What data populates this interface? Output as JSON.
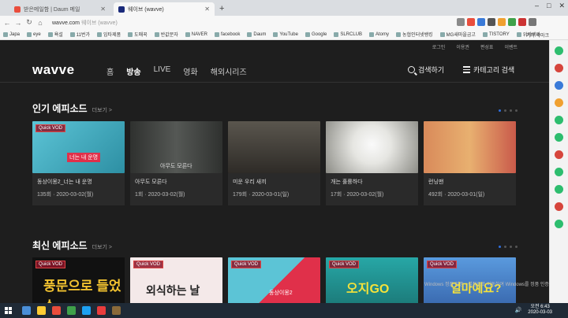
{
  "browser": {
    "tabs": [
      {
        "label": "받은메일함 | Daum 메일",
        "favicon_color": "#e94d3c",
        "active": false
      },
      {
        "label": "웨이브 (wavve)",
        "favicon_color": "#1a2a7a",
        "active": true
      }
    ],
    "new_tab": "+",
    "window_controls": [
      "–",
      "□",
      "✕"
    ],
    "url": "wavve.com",
    "url_title": "웨이브 (wavve)",
    "bookmarks": [
      "Japa",
      "eye",
      "욕설",
      "11번가",
      "임타제품",
      "도매꾹",
      "반값문자",
      "NAVER",
      "facebook",
      "Daum",
      "YouTube",
      "Google",
      "SLRCLUB",
      "Atomy",
      "농협인터넷뱅킹",
      "MG새마을금고",
      "TISTORY",
      "위키백과"
    ],
    "other_bookmarks": "기타 북마크"
  },
  "site": {
    "util_links": [
      "로그인",
      "이용권",
      "편성표",
      "이벤트"
    ],
    "logo": "wavve",
    "menu": [
      {
        "label": "홈",
        "active": false
      },
      {
        "label": "방송",
        "active": true
      },
      {
        "label": "LIVE",
        "active": false
      },
      {
        "label": "영화",
        "active": false
      },
      {
        "label": "해외시리즈",
        "active": false
      }
    ],
    "search_label": "검색하기",
    "category_label": "카테고리 검색"
  },
  "popular": {
    "title": "인기 에피소드",
    "more": "더보기 >",
    "cards": [
      {
        "badge": "Quick VOD",
        "title": "동상이몽2_너는 내 운명",
        "episode": "135회",
        "date": "2020-03-02(월)",
        "thumb_color": "#4fb3c7",
        "thumb_text": "너는 내 운명"
      },
      {
        "badge": "",
        "title": "아무도 모른다",
        "episode": "1회",
        "date": "2020-03-02(월)",
        "thumb_color": "#3a3c3a",
        "thumb_text": "아무도 모른다"
      },
      {
        "badge": "",
        "title": "미운 우리 새끼",
        "episode": "179회",
        "date": "2020-03-01(일)",
        "thumb_color": "#4a4640",
        "thumb_text": ""
      },
      {
        "badge": "",
        "title": "개는 훌륭하다",
        "episode": "17회",
        "date": "2020-03-02(월)",
        "thumb_color": "#d8d8d4",
        "thumb_text": ""
      },
      {
        "badge": "",
        "title": "런닝맨",
        "episode": "492회",
        "date": "2020-03-01(일)",
        "thumb_color": "#c46a4a",
        "thumb_text": ""
      }
    ]
  },
  "recent": {
    "title": "최신 에피소드",
    "more": "더보기 >",
    "cards": [
      {
        "badge": "Quick VOD",
        "thumb_color": "#111111",
        "thumb_text": "풍문으로 들었쇼"
      },
      {
        "badge": "Quick VOD",
        "thumb_color": "#f4e9e9",
        "thumb_text": "외식하는 날"
      },
      {
        "badge": "Quick VOD",
        "thumb_color": "#4fb3c7",
        "thumb_text": "동상이몽2"
      },
      {
        "badge": "Quick VOD",
        "thumb_color": "#27a7a6",
        "thumb_text": "오지GO"
      },
      {
        "badge": "Quick VOD",
        "thumb_color": "#4a8ad0",
        "thumb_text": "얼마예요?"
      }
    ]
  },
  "watermark": "Windows 정품 인증 · 설정으로 이동하여 Windows를 정품 인증합니다.",
  "taskbar": {
    "time": "오전 6:43",
    "date": "2020-03-03",
    "icons": [
      "#4a8fd8",
      "#ffcc33",
      "#e94d3c",
      "#3fa14a",
      "#1da1f2",
      "#e93c3c",
      "#8a6a3a"
    ]
  },
  "colors": {
    "accent": "#2f6fde",
    "badge_border": "#dd4444",
    "page_bg": "#1e1e1e"
  }
}
